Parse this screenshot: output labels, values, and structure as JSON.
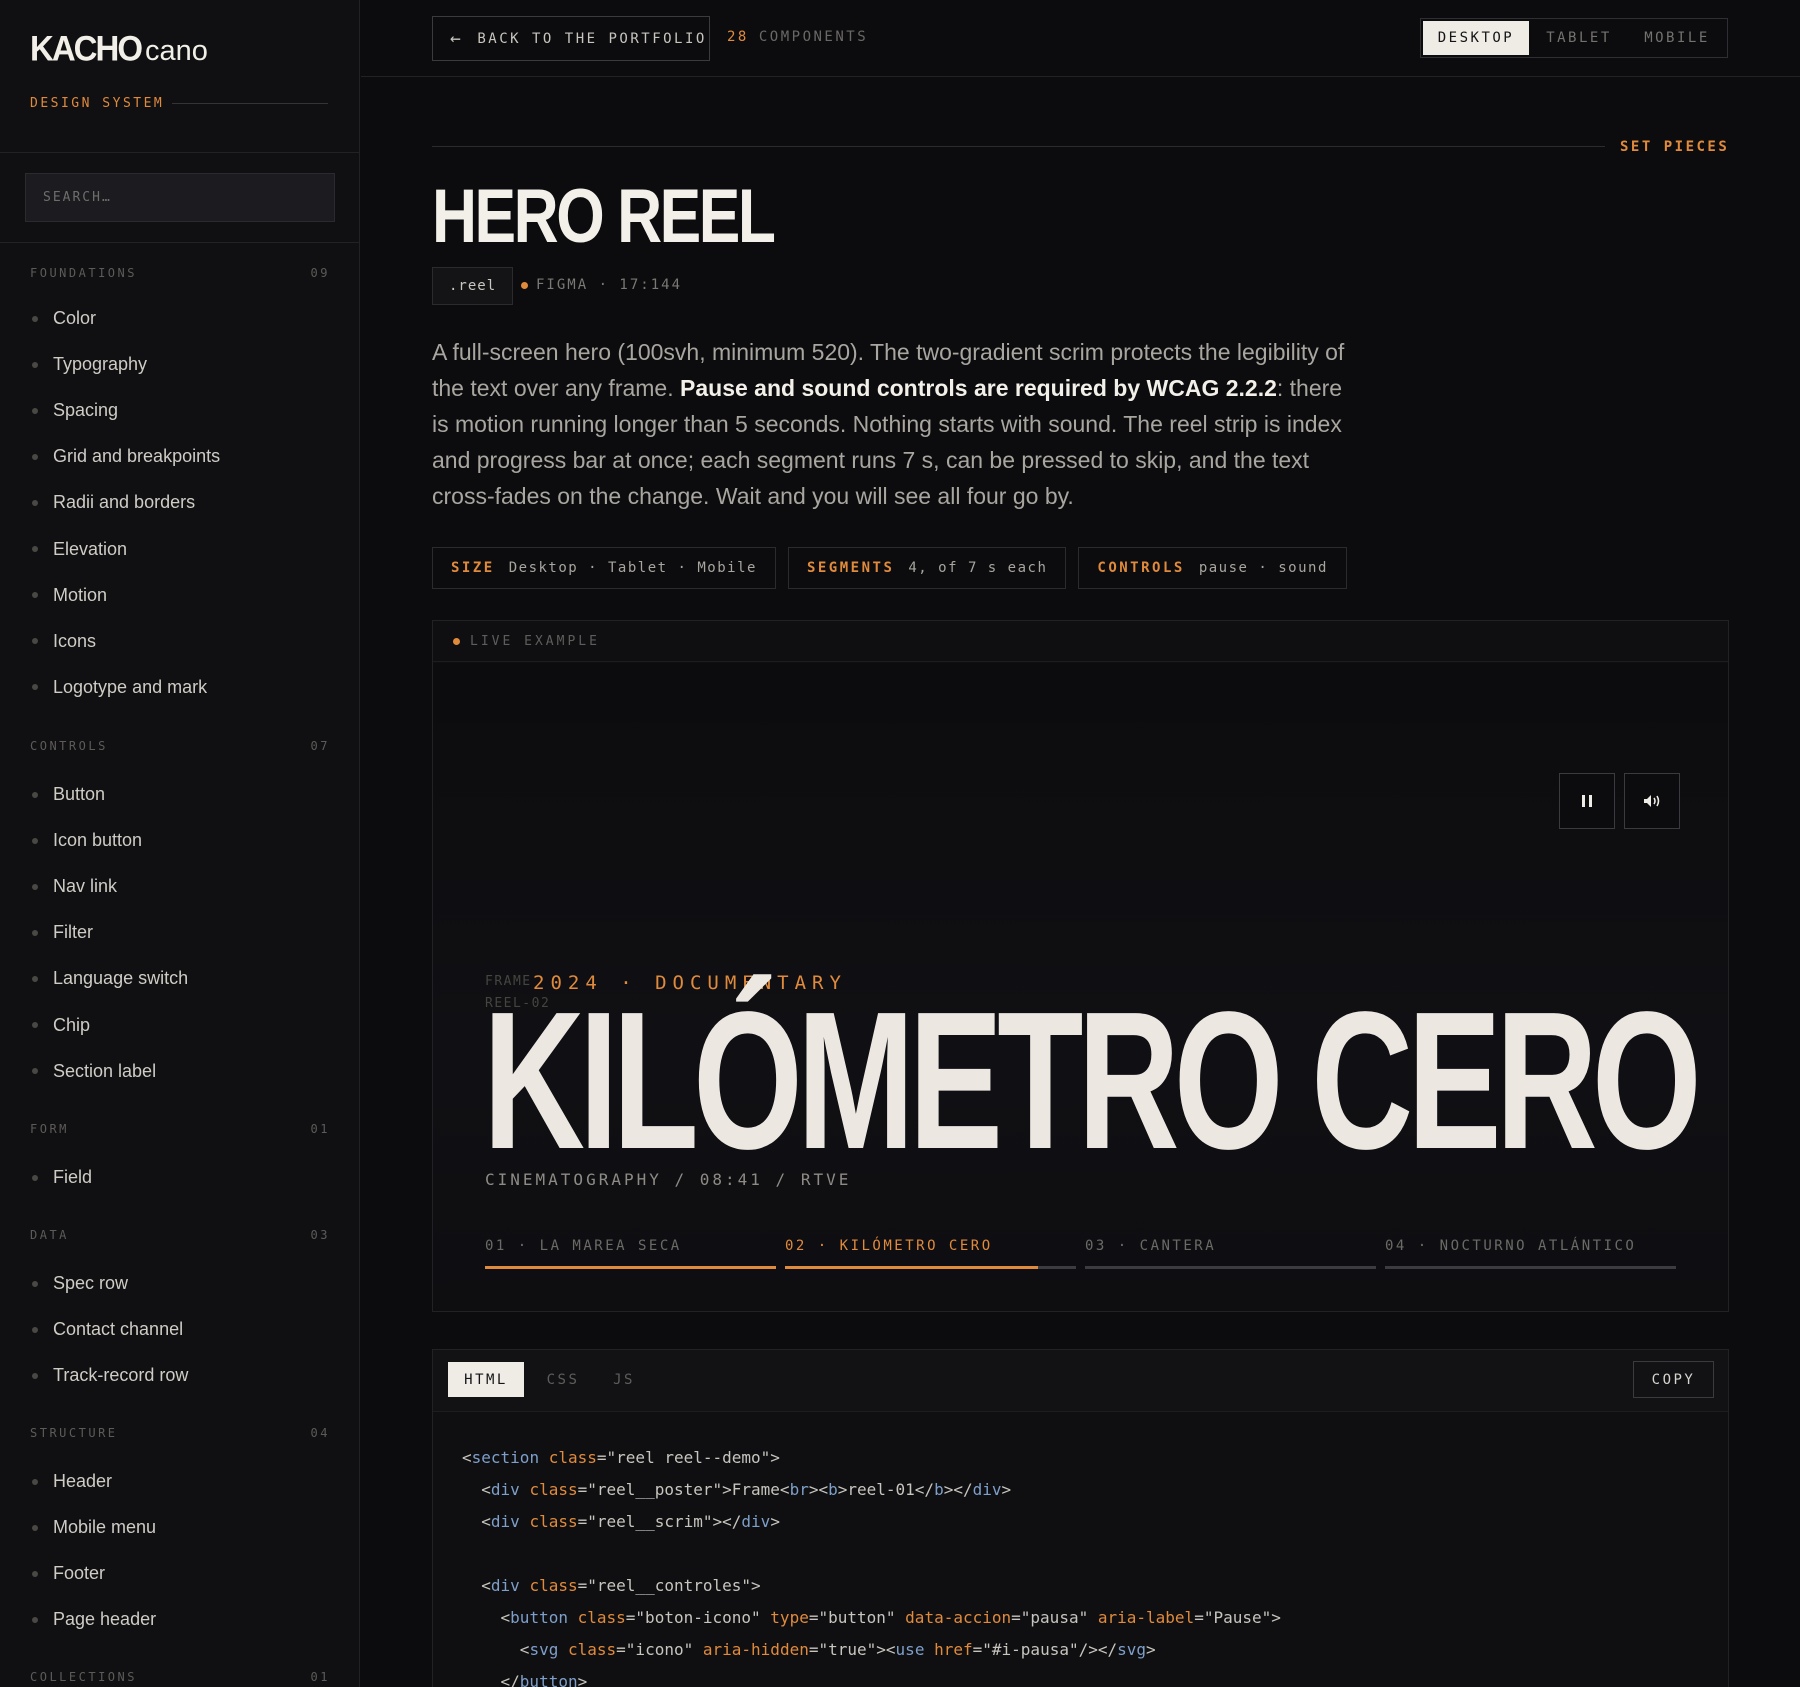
{
  "brand": {
    "logo_bold": "KACHO",
    "logo_light": "cano",
    "tagline": "DESIGN SYSTEM"
  },
  "search": {
    "placeholder": "SEARCH…"
  },
  "sidebar": {
    "sections": [
      {
        "title": "FOUNDATIONS",
        "count": "09",
        "items": [
          "Color",
          "Typography",
          "Spacing",
          "Grid and breakpoints",
          "Radii and borders",
          "Elevation",
          "Motion",
          "Icons",
          "Logotype and mark"
        ]
      },
      {
        "title": "CONTROLS",
        "count": "07",
        "items": [
          "Button",
          "Icon button",
          "Nav link",
          "Filter",
          "Language switch",
          "Chip",
          "Section label"
        ]
      },
      {
        "title": "FORM",
        "count": "01",
        "items": [
          "Field"
        ]
      },
      {
        "title": "DATA",
        "count": "03",
        "items": [
          "Spec row",
          "Contact channel",
          "Track-record row"
        ]
      },
      {
        "title": "STRUCTURE",
        "count": "04",
        "items": [
          "Header",
          "Mobile menu",
          "Footer",
          "Page header"
        ]
      },
      {
        "title": "COLLECTIONS",
        "count": "01",
        "items": []
      }
    ]
  },
  "topbar": {
    "back_label": "BACK TO THE PORTFOLIO",
    "count_num": "28",
    "count_label": "COMPONENTS",
    "devices": [
      "DESKTOP",
      "TABLET",
      "MOBILE"
    ],
    "active_device": "DESKTOP"
  },
  "page": {
    "section_label": "SET PIECES",
    "title": "HERO REEL",
    "class_tag": ".reel",
    "figma_ref": "FIGMA · 17:144",
    "desc_1": "A full-screen hero (100svh, minimum 520). The two-gradient scrim protects the legibility of the text over any frame. ",
    "desc_bold": "Pause and sound controls are required by WCAG 2.2.2",
    "desc_2": ": there is motion running longer than 5 seconds. Nothing starts with sound. The reel strip is index and progress bar at once; each segment runs 7 s, can be pressed to skip, and the text cross-fades on the change. Wait and you will see all four go by.",
    "specs": [
      {
        "key": "SIZE",
        "value": "Desktop · Tablet · Mobile"
      },
      {
        "key": "SEGMENTS",
        "value": "4, of 7 s each"
      },
      {
        "key": "CONTROLS",
        "value": "pause · sound"
      }
    ]
  },
  "demo": {
    "header": "LIVE EXAMPLE",
    "frame_label_1": "FRAME",
    "frame_label_2": "REEL-02",
    "meta_top": "2024 · DOCUMENTARY",
    "reel_title": "KILÓMETRO CERO",
    "meta_bottom": "CINEMATOGRAPHY  /  08:41  /  RTVE",
    "pause_icon": "pause-icon",
    "sound_icon": "sound-icon",
    "segments": [
      {
        "label": "01 · LA MAREA SECA",
        "progress": 1.0
      },
      {
        "label": "02 · KILÓMETRO CERO",
        "progress": 0.87
      },
      {
        "label": "03 · CANTERA",
        "progress": 0
      },
      {
        "label": "04 · NOCTURNO ATLÁNTICO",
        "progress": 0
      }
    ],
    "active_segment": 1
  },
  "code": {
    "tabs": [
      "HTML",
      "CSS",
      "JS"
    ],
    "active_tab": "HTML",
    "copy_label": "COPY"
  },
  "colors": {
    "accent": "#e08a3c",
    "bg": "#0c0c0e",
    "text": "#e8e4dc"
  }
}
